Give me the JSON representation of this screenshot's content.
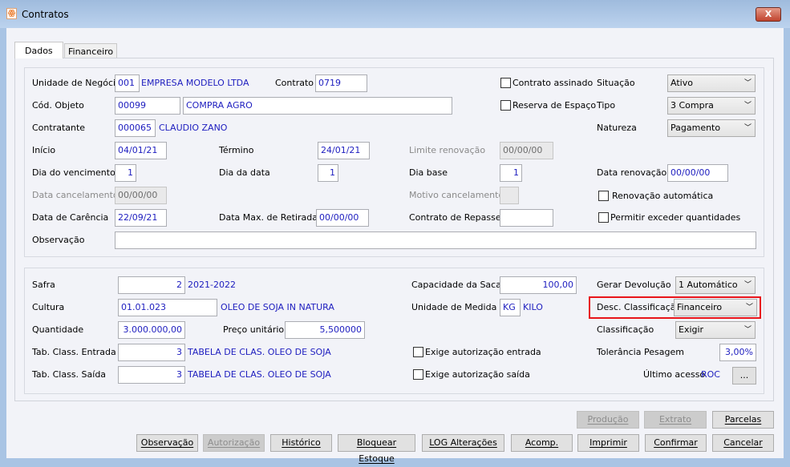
{
  "window": {
    "title": "Contratos",
    "close": "X"
  },
  "tabs": [
    {
      "label": "Dados"
    },
    {
      "label": "Financeiro"
    }
  ],
  "dados": {
    "unidade_label": "Unidade de Negócio",
    "unidade_code": "001",
    "unidade_name": "EMPRESA MODELO LTDA",
    "contrato_label": "Contrato",
    "contrato": "0719",
    "contrato_assinado": "Contrato assinado",
    "reserva_espaco": "Reserva de Espaço",
    "situacao_label": "Situação",
    "situacao": "Ativo",
    "tipo_label": "Tipo",
    "tipo": "3 Compra",
    "natureza_label": "Natureza",
    "natureza": "Pagamento",
    "cod_objeto_label": "Cód. Objeto",
    "cod_objeto": "00099",
    "objeto_desc": "COMPRA AGRO",
    "contratante_label": "Contratante",
    "contratante_code": "000065",
    "contratante_name": "CLAUDIO ZANO",
    "inicio_label": "Início",
    "inicio": "04/01/21",
    "termino_label": "Término",
    "termino": "24/01/21",
    "limite_label": "Limite renovação",
    "limite": "00/00/00",
    "dia_venc_label": "Dia do vencimento",
    "dia_venc": "1",
    "dia_data_label": "Dia da data",
    "dia_data": "1",
    "dia_base_label": "Dia base",
    "dia_base": "1",
    "data_renov_label": "Data renovação",
    "data_renov": "00/00/00",
    "data_cancel_label": "Data cancelamento",
    "data_cancel": "00/00/00",
    "motivo_label": "Motivo cancelamento",
    "renov_auto": "Renovação automática",
    "carencia_label": "Data de Carência",
    "carencia": "22/09/21",
    "max_retirada_label": "Data Max. de Retirada",
    "max_retirada": "00/00/00",
    "repasse_label": "Contrato de Repasse",
    "repasse": "",
    "permitir_exceder": "Permitir exceder quantidades",
    "observacao_label": "Observação",
    "observacao": ""
  },
  "produto": {
    "safra_label": "Safra",
    "safra_code": "2",
    "safra_name": "2021-2022",
    "capacidade_label": "Capacidade da Saca",
    "capacidade": "100,00",
    "gerar_dev_label": "Gerar Devolução",
    "gerar_dev": "1 Automático",
    "cultura_label": "Cultura",
    "cultura_code": "01.01.023",
    "cultura_name": "OLEO DE SOJA IN NATURA",
    "unidade_med_label": "Unidade de Medida",
    "unidade_med": "KG",
    "unidade_med_name": "KILO",
    "desc_class_label": "Desc. Classificação",
    "desc_class": "Financeiro",
    "quantidade_label": "Quantidade",
    "quantidade": "3.000.000,00",
    "preco_label": "Preço unitário",
    "preco": "5,500000",
    "classificacao_label": "Classificação",
    "classificacao": "Exigir",
    "entrada_label": "Tab. Class. Entrada",
    "entrada_code": "3",
    "entrada_name": "TABELA DE CLAS. OLEO DE SOJA",
    "exige_entrada": "Exige autorização entrada",
    "tolerancia_label": "Tolerância Pesagem",
    "tolerancia": "3,00%",
    "saida_label": "Tab. Class. Saída",
    "saida_code": "3",
    "saida_name": "TABELA DE CLAS. OLEO DE SOJA",
    "exige_saida": "Exige autorização saída",
    "ultimo_label": "Último acesso",
    "ultimo": "ROC",
    "ellipsis": "..."
  },
  "buttons": {
    "producao": "Produção",
    "extrato": "Extrato",
    "parcelas": "Parcelas",
    "observacao": "Observação",
    "autorizacao": "Autorização",
    "historico": "Histórico",
    "bloquear": "Bloquear Estoque",
    "log": "LOG Alterações",
    "acomp": "Acomp.",
    "imprimir": "Imprimir",
    "confirmar": "Confirmar",
    "cancelar": "Cancelar"
  },
  "colors": {
    "highlight": "#e8141a",
    "value_text": "#1d1dbf"
  }
}
